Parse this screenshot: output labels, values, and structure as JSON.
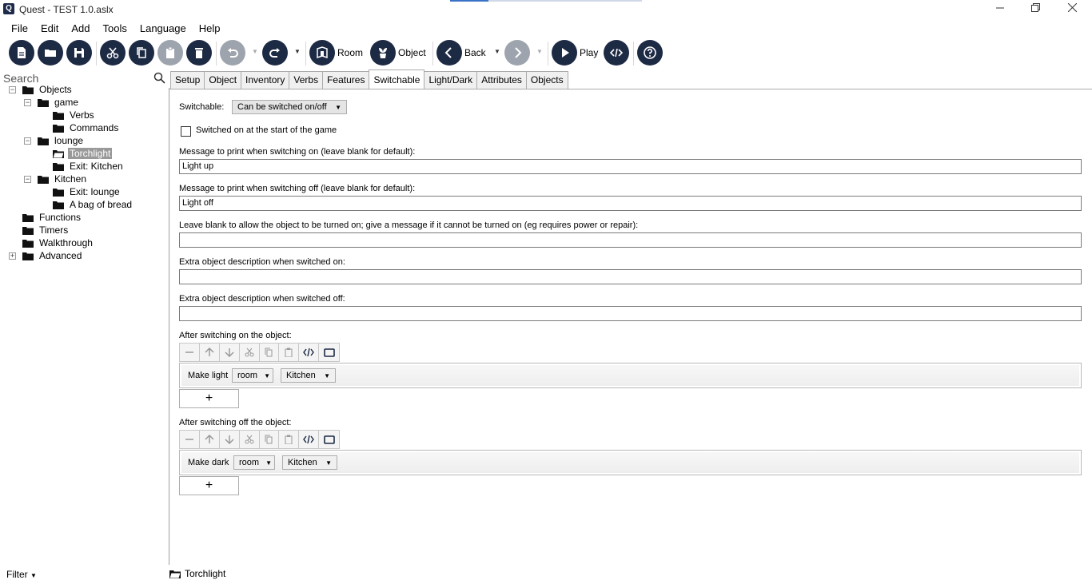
{
  "window": {
    "title": "Quest - TEST 1.0.aslx",
    "app_icon": "Q",
    "controls": [
      "minimize",
      "restore",
      "close"
    ]
  },
  "menu": [
    "File",
    "Edit",
    "Add",
    "Tools",
    "Language",
    "Help"
  ],
  "toolbar": {
    "room_label": "Room",
    "object_label": "Object",
    "back_label": "Back",
    "play_label": "Play"
  },
  "left": {
    "search_placeholder": "Search",
    "filter_label": "Filter",
    "tree": [
      {
        "label": "Objects",
        "depth": 0,
        "expanded": true
      },
      {
        "label": "game",
        "depth": 1,
        "expanded": true
      },
      {
        "label": "Verbs",
        "depth": 2
      },
      {
        "label": "Commands",
        "depth": 2
      },
      {
        "label": "lounge",
        "depth": 1,
        "expanded": true
      },
      {
        "label": "Torchlight",
        "depth": 2,
        "selected": true
      },
      {
        "label": "Exit: Kitchen",
        "depth": 2
      },
      {
        "label": "Kitchen",
        "depth": 1,
        "expanded": true
      },
      {
        "label": "Exit: lounge",
        "depth": 2
      },
      {
        "label": "A bag of bread",
        "depth": 2
      },
      {
        "label": "Functions",
        "depth": 0
      },
      {
        "label": "Timers",
        "depth": 0
      },
      {
        "label": "Walkthrough",
        "depth": 0
      },
      {
        "label": "Advanced",
        "depth": 0,
        "collapsed": true
      }
    ]
  },
  "tabs": [
    "Setup",
    "Object",
    "Inventory",
    "Verbs",
    "Features",
    "Switchable",
    "Light/Dark",
    "Attributes",
    "Objects"
  ],
  "active_tab": "Switchable",
  "switchable": {
    "switchable_label": "Switchable:",
    "switchable_value": "Can be switched on/off",
    "start_on_label": "Switched on at the start of the game",
    "start_on_checked": false,
    "msg_on_label": "Message to print when switching on (leave blank for default):",
    "msg_on_value": "Light up",
    "msg_off_label": "Message to print when switching off (leave blank for default):",
    "msg_off_value": "Light off",
    "cannot_on_label": "Leave blank to allow the object to be turned on; give a message if it cannot be turned on (eg requires power or repair):",
    "cannot_on_value": "",
    "desc_on_label": "Extra object description when switched on:",
    "desc_on_value": "",
    "desc_off_label": "Extra object description when switched off:",
    "desc_off_value": "",
    "after_on_label": "After switching on the object:",
    "after_on_script": {
      "command": "Make light",
      "scope": "room",
      "target": "Kitchen"
    },
    "after_off_label": "After switching off the object:",
    "after_off_script": {
      "command": "Make dark",
      "scope": "room",
      "target": "Kitchen"
    },
    "add_label": "+"
  },
  "status": {
    "current": "Torchlight"
  }
}
